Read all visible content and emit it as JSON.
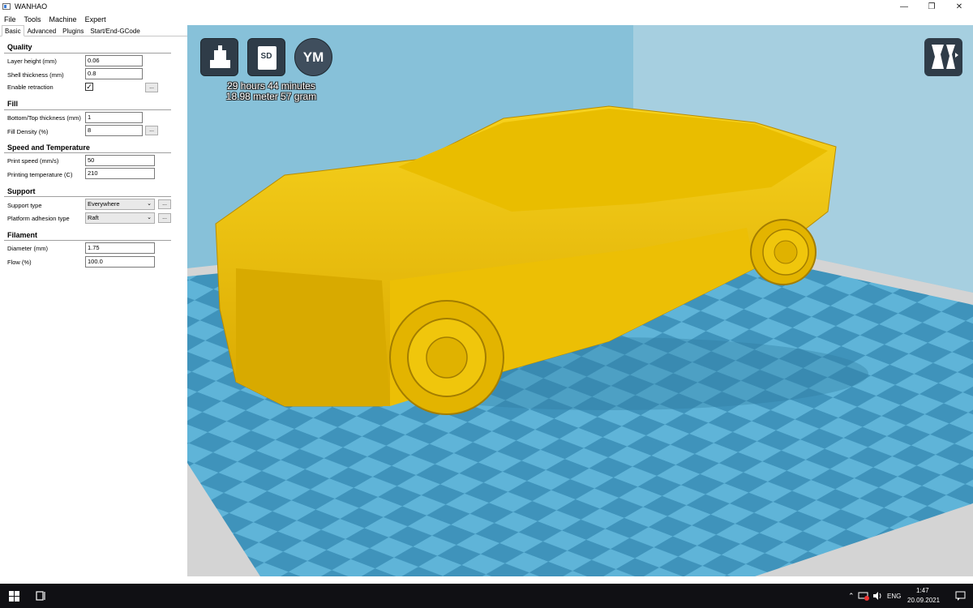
{
  "window": {
    "title": "WANHAO"
  },
  "menu": [
    "File",
    "Tools",
    "Machine",
    "Expert"
  ],
  "tabs": [
    "Basic",
    "Advanced",
    "Plugins",
    "Start/End-GCode"
  ],
  "sections": {
    "quality": {
      "title": "Quality",
      "layer_height": {
        "label": "Layer height (mm)",
        "value": "0.06"
      },
      "shell_thickness": {
        "label": "Shell thickness (mm)",
        "value": "0.8"
      },
      "enable_retraction": {
        "label": "Enable retraction",
        "checked": true,
        "mark": "✓"
      }
    },
    "fill": {
      "title": "Fill",
      "bottom_top": {
        "label": "Bottom/Top thickness (mm)",
        "value": "1"
      },
      "fill_density": {
        "label": "Fill Density (%)",
        "value": "8"
      }
    },
    "speed": {
      "title": "Speed and Temperature",
      "print_speed": {
        "label": "Print speed (mm/s)",
        "value": "50"
      },
      "print_temp": {
        "label": "Printing temperature (C)",
        "value": "210"
      }
    },
    "support": {
      "title": "Support",
      "support_type": {
        "label": "Support type",
        "value": "Everywhere"
      },
      "adhesion": {
        "label": "Platform adhesion type",
        "value": "Raft"
      }
    },
    "filament": {
      "title": "Filament",
      "diameter": {
        "label": "Diameter (mm)",
        "value": "1.75"
      },
      "flow": {
        "label": "Flow (%)",
        "value": "100.0"
      }
    }
  },
  "more_button_label": "...",
  "dropdown_arrow": "⌄",
  "viewport": {
    "sd_label": "SD",
    "ym_label": "YM",
    "print_time": "29 hours 44 minutes",
    "print_material": "18.98 meter 57 gram",
    "model_color": "#f2c200",
    "platform_light": "#5fb4d8",
    "platform_dark": "#3f93bb"
  },
  "window_controls": {
    "minimize": "—",
    "restore": "❐",
    "close": "✕"
  },
  "taskbar": {
    "language": "ENG",
    "time": "1:47",
    "date": "20.09.2021"
  }
}
